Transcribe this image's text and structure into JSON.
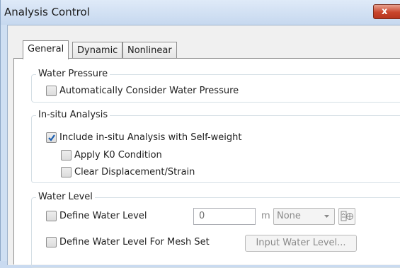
{
  "window": {
    "title": "Analysis Control",
    "close_label": "x"
  },
  "tabs": [
    {
      "label": "General",
      "active": true
    },
    {
      "label": "Dynamic",
      "active": false
    },
    {
      "label": "Nonlinear",
      "active": false
    }
  ],
  "water_pressure": {
    "legend": "Water Pressure",
    "auto_consider": {
      "label": "Automatically Consider Water Pressure",
      "checked": false
    }
  },
  "insitu": {
    "legend": "In-situ Analysis",
    "include": {
      "label": "Include in-situ Analysis with Self-weight",
      "checked": true
    },
    "apply_k0": {
      "label": "Apply K0 Condition",
      "checked": false
    },
    "clear_disp": {
      "label": "Clear Displacement/Strain",
      "checked": false
    }
  },
  "water_level": {
    "legend": "Water Level",
    "define": {
      "label": "Define Water Level",
      "checked": false
    },
    "value": "0",
    "unit": "m",
    "combo_value": "None",
    "icon": "water-level-pick-icon",
    "define_mesh": {
      "label": "Define Water Level For Mesh Set",
      "checked": false
    },
    "input_button": "Input Water Level..."
  },
  "colors": {
    "accent_check": "#1c5fb0",
    "window_frame": "#cfdff2",
    "close_red": "#c9452c"
  }
}
